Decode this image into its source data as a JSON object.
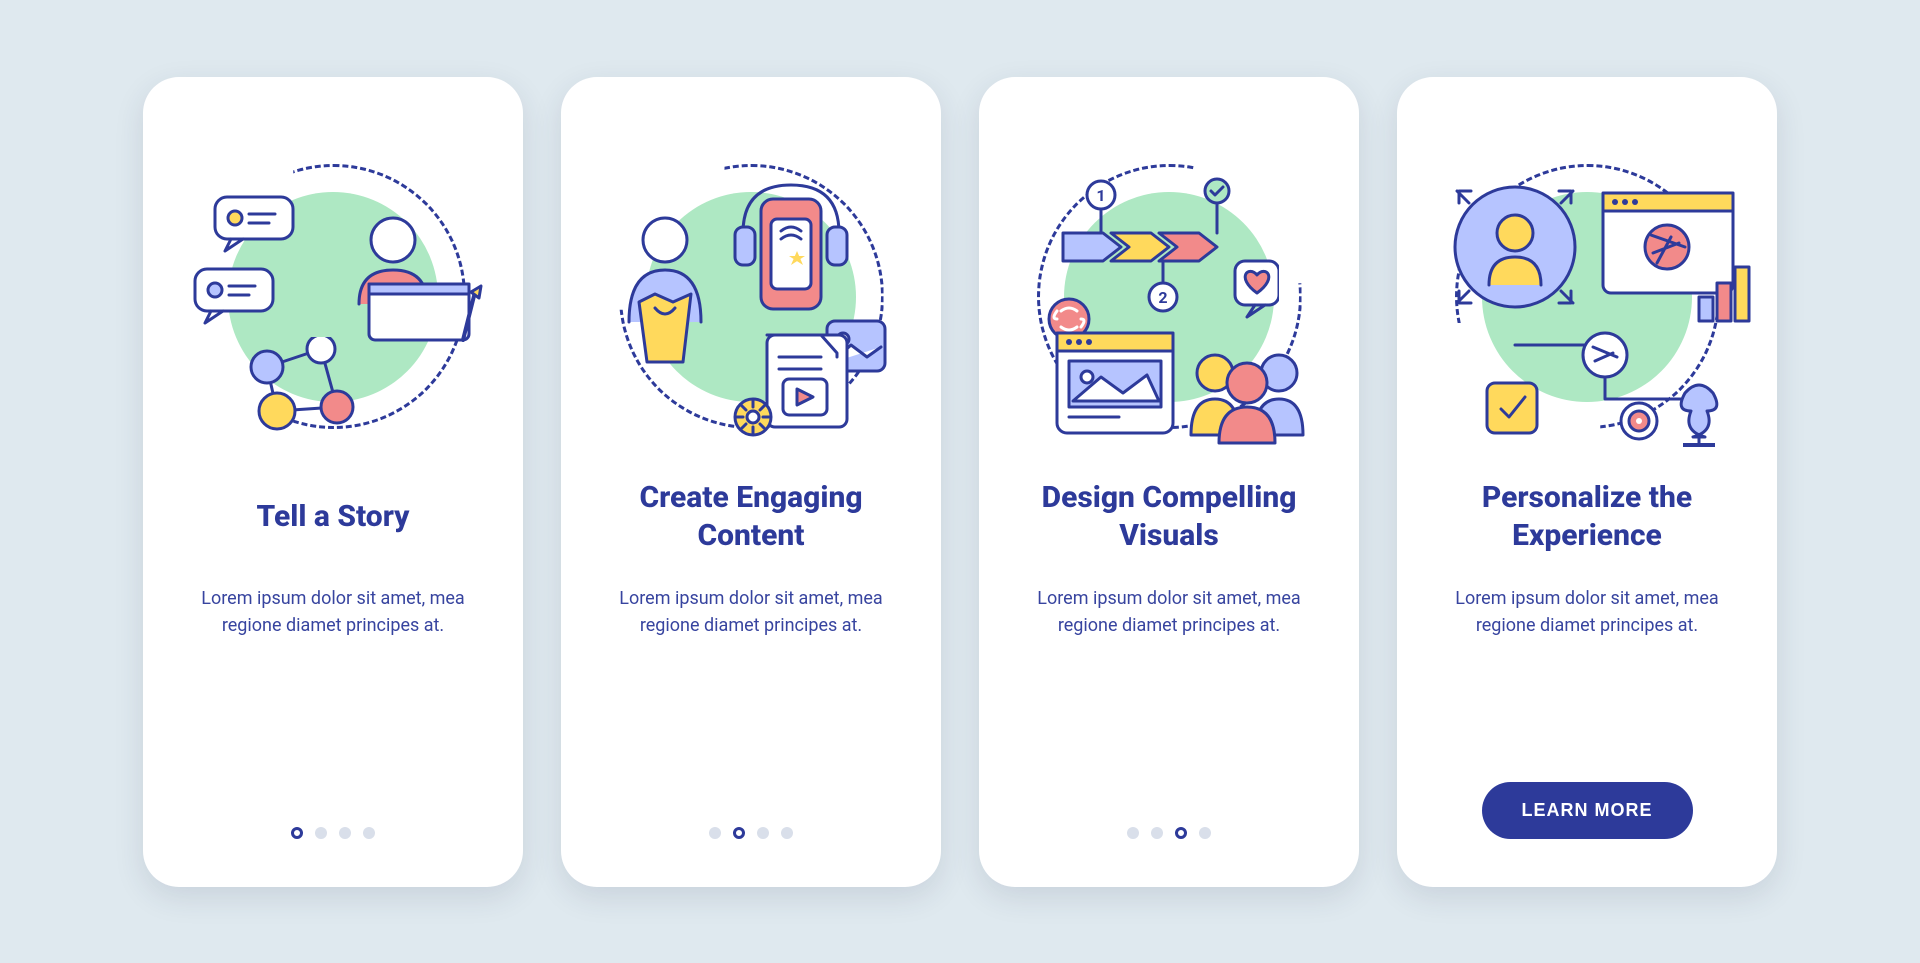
{
  "colors": {
    "primary": "#2d3a9a",
    "accentGreen": "#aee8c3",
    "accentYellow": "#ffd95c",
    "accentRed": "#f28a8a",
    "background": "#dfe9ef",
    "card": "#ffffff"
  },
  "cards": [
    {
      "title": "Tell a Story",
      "description": "Lorem ipsum dolor sit amet, mea regione diamet principes at.",
      "slideCount": 4,
      "activeIndex": 0,
      "hasCta": false
    },
    {
      "title": "Create Engaging Content",
      "description": "Lorem ipsum dolor sit amet, mea regione diamet principes at.",
      "slideCount": 4,
      "activeIndex": 1,
      "hasCta": false
    },
    {
      "title": "Design Compelling Visuals",
      "description": "Lorem ipsum dolor sit amet, mea regione diamet principes at.",
      "slideCount": 4,
      "activeIndex": 2,
      "hasCta": false
    },
    {
      "title": "Personalize the Experience",
      "description": "Lorem ipsum dolor sit amet, mea regione diamet principes at.",
      "slideCount": 4,
      "activeIndex": 3,
      "hasCta": true
    }
  ],
  "cta_label": "LEARN MORE"
}
